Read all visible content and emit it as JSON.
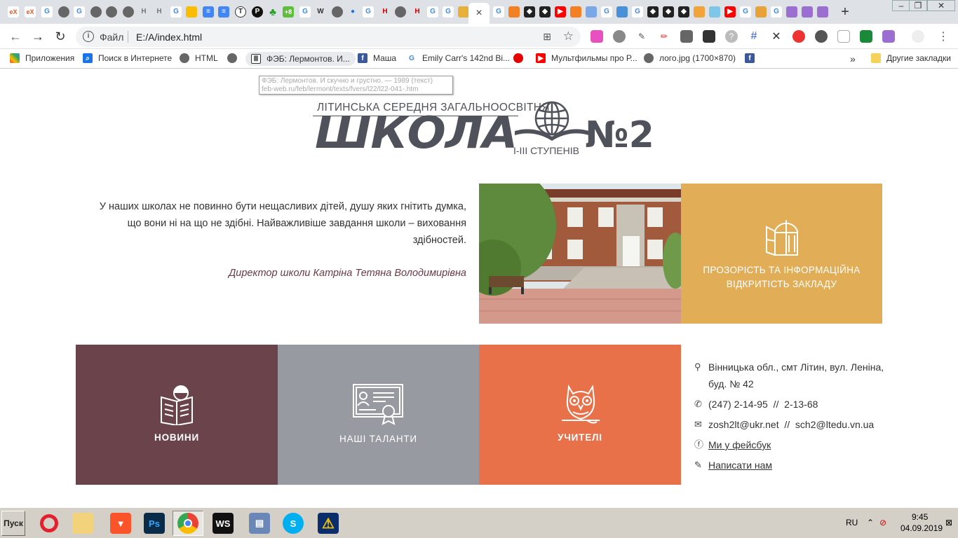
{
  "browser": {
    "tabs_active_close": "×",
    "new_tab": "+",
    "omnibox": {
      "scheme": "Файл",
      "url": "E:/A/index.html"
    },
    "bookmarks": [
      {
        "label": "Приложения"
      },
      {
        "label": "Поиск в Интернете"
      },
      {
        "label": "HTML"
      },
      {
        "label": "ФЭБ: Лермонтов. И..."
      },
      {
        "label": "Маша"
      },
      {
        "label": "Emily Carr's 142nd Bi..."
      },
      {
        "label": "Мультфильмы про Р..."
      },
      {
        "label": "лого.jpg (1700×870)"
      },
      {
        "label": "Другие закладки"
      }
    ],
    "bookmarks_more": "»",
    "tooltip": {
      "line1": "ФЭБ: Лермонтов. И скучно и грустно. — 1989 (текст)",
      "line2": "feb-web.ru/feb/lermont/texts/fvers/l22/l22-041-.htm"
    }
  },
  "logo": {
    "top": "ЛІТИНСЬКА СЕРЕДНЯ ЗАГАЛЬНООСВІТНЯ",
    "big": "ШКОЛА",
    "steps": "І-ІІІ СТУПЕНІВ",
    "num": "№2"
  },
  "quote": {
    "text": "У наших школах не повинно бути нещасливих дітей, душу яких гнітить думка, що вони ні на що не здібні. Найважливіше завдання школи – виховання здібностей.",
    "author": "Директор школи Катріна Тетяна Володимирівна"
  },
  "transparency": {
    "line1": "ПРОЗОРІСТЬ ТА ІНФОРМАЦІЙНА",
    "line2": "ВІДКРИТІСТЬ ЗАКЛАДУ"
  },
  "tiles": {
    "news": "НОВИНИ",
    "talents": "НАШІ ТАЛАНТИ",
    "teachers": "УЧИТЕЛІ"
  },
  "contacts": {
    "address1": "Вінницька обл., смт Літин, вул. Леніна,",
    "address2": "буд. № 42",
    "phone": "(247) 2-14-95  //  2-13-68",
    "email": "zosh2lt@ukr.net  //  sch2@ltedu.vn.ua",
    "facebook": "Ми у фейсбук",
    "write": "Написати нам"
  },
  "taskbar": {
    "start": "Пуск",
    "lang": "RU",
    "time": "9:45",
    "date": "04.09.2019"
  },
  "colors": {
    "news": "#6a434b",
    "talents": "#979aa0",
    "teachers": "#e8714a",
    "transparency": "#e2ad57",
    "logo": "#50525b"
  }
}
